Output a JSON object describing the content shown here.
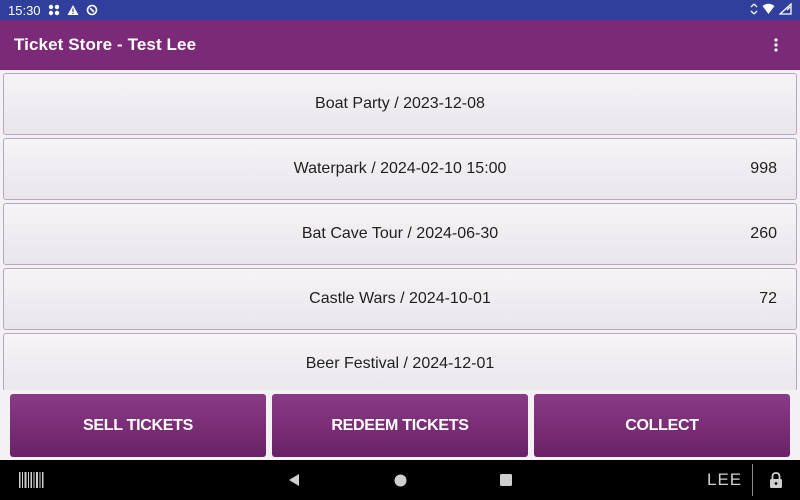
{
  "status_bar": {
    "time": "15:30",
    "icons_left": [
      "apps-icon",
      "warning-icon",
      "sync-icon"
    ],
    "icons_right": [
      "bluetooth-arrows-icon",
      "wifi-icon",
      "battery-icon"
    ]
  },
  "app_bar": {
    "title": "Ticket Store - Test Lee",
    "menu_icon": "more-vert-icon"
  },
  "events": [
    {
      "label": "Boat Party / 2023-12-08",
      "count": ""
    },
    {
      "label": "Waterpark / 2024-02-10 15:00",
      "count": "998"
    },
    {
      "label": "Bat Cave Tour / 2024-06-30",
      "count": "260"
    },
    {
      "label": "Castle Wars / 2024-10-01",
      "count": "72"
    },
    {
      "label": "Beer Festival / 2024-12-01",
      "count": ""
    }
  ],
  "actions": {
    "sell": "SELL TICKETS",
    "redeem": "REDEEM TICKETS",
    "collect": "COLLECT"
  },
  "nav_bar": {
    "user": "LEE",
    "icons": [
      "barcode-icon",
      "back-icon",
      "home-icon",
      "recents-icon",
      "lock-icon"
    ]
  },
  "colors": {
    "status_bar": "#2f3f9b",
    "app_bar": "#7b2a78",
    "button": "#7b2a78",
    "nav_bar": "#000000"
  }
}
